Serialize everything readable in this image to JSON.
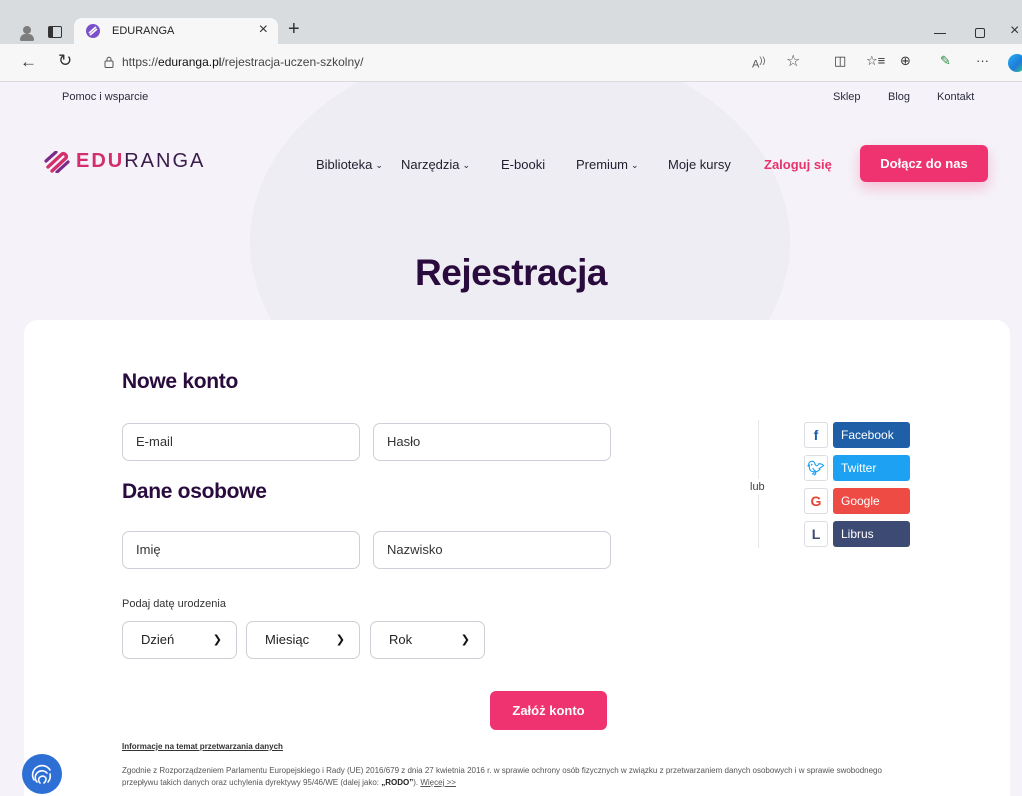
{
  "browser": {
    "tab_title": "EDURANGA",
    "url_prefix": "https://",
    "url_host": "eduranga.pl",
    "url_path": "/rejestracja-uczen-szkolny/",
    "new_tab_symbol": "+",
    "close_symbol": "×"
  },
  "topbar": {
    "help": "Pomoc i wsparcie",
    "links": [
      "Sklep",
      "Blog",
      "Kontakt"
    ]
  },
  "logo": {
    "part1": "EDU",
    "part2": "RANGA"
  },
  "nav": {
    "items": [
      {
        "label": "Biblioteka",
        "has_dropdown": true
      },
      {
        "label": "Narzędzia",
        "has_dropdown": true
      },
      {
        "label": "E-booki",
        "has_dropdown": false
      },
      {
        "label": "Premium",
        "has_dropdown": true
      },
      {
        "label": "Moje kursy",
        "has_dropdown": false
      }
    ],
    "login": "Zaloguj się",
    "join": "Dołącz do nas"
  },
  "page_title": "Rejestracja",
  "form": {
    "new_account_heading": "Nowe konto",
    "email_placeholder": "E-mail",
    "password_placeholder": "Hasło",
    "personal_heading": "Dane osobowe",
    "first_name_placeholder": "Imię",
    "last_name_placeholder": "Nazwisko",
    "dob_label": "Podaj datę urodzenia",
    "day_label": "Dzień",
    "month_label": "Miesiąc",
    "year_label": "Rok",
    "submit": "Załóż konto"
  },
  "social": {
    "or_text": "lub",
    "buttons": [
      {
        "label": "Facebook",
        "icon": "facebook-icon",
        "color": "#1f5fa8"
      },
      {
        "label": "Twitter",
        "icon": "twitter-icon",
        "color": "#1da1f2"
      },
      {
        "label": "Google",
        "icon": "google-icon",
        "color": "#ee4b45"
      },
      {
        "label": "Librus",
        "icon": "librus-icon",
        "color": "#3d4a73"
      }
    ]
  },
  "privacy": {
    "title": "Informacje na temat przetwarzania danych",
    "text": "Zgodnie z Rozporządzeniem Parlamentu Europejskiego i Rady (UE) 2016/679 z dnia 27 kwietnia 2016 r. w sprawie ochrony osób fizycznych w związku z przetwarzaniem danych osobowych i w sprawie swobodnego przepływu takich danych oraz uchylenia dyrektywy 95/46/WE (dalej jako: ",
    "rodo": "„RODO”",
    "text_end": "). ",
    "more": "Więcej >>"
  },
  "colors": {
    "brand_pink": "#ef3270",
    "brand_dark": "#2a0b3d"
  }
}
